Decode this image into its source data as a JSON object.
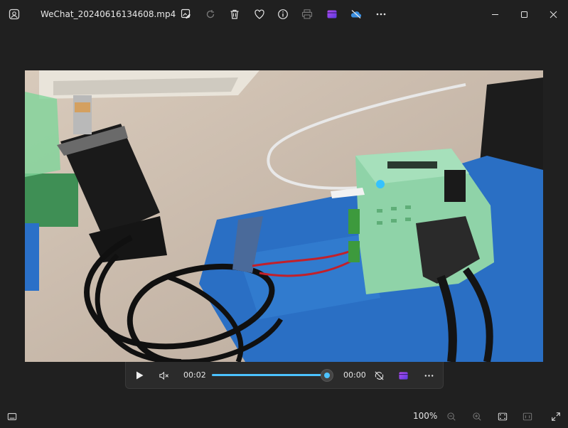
{
  "window": {
    "title": "WeChat_20240616134608.mp4"
  },
  "toolbar": {
    "icons": [
      "edit-icon",
      "rotate-icon",
      "delete-icon",
      "favorite-icon",
      "info-icon",
      "print-icon",
      "clipchamp-icon",
      "onedrive-icon",
      "more-icon"
    ]
  },
  "player": {
    "current_time": "00:02",
    "remaining_time": "00:00",
    "progress": 1.0
  },
  "statusbar": {
    "zoom_level": "100%"
  },
  "colors": {
    "background": "#202020",
    "accent": "#4cc2ff",
    "text": "#e6e6e6"
  }
}
